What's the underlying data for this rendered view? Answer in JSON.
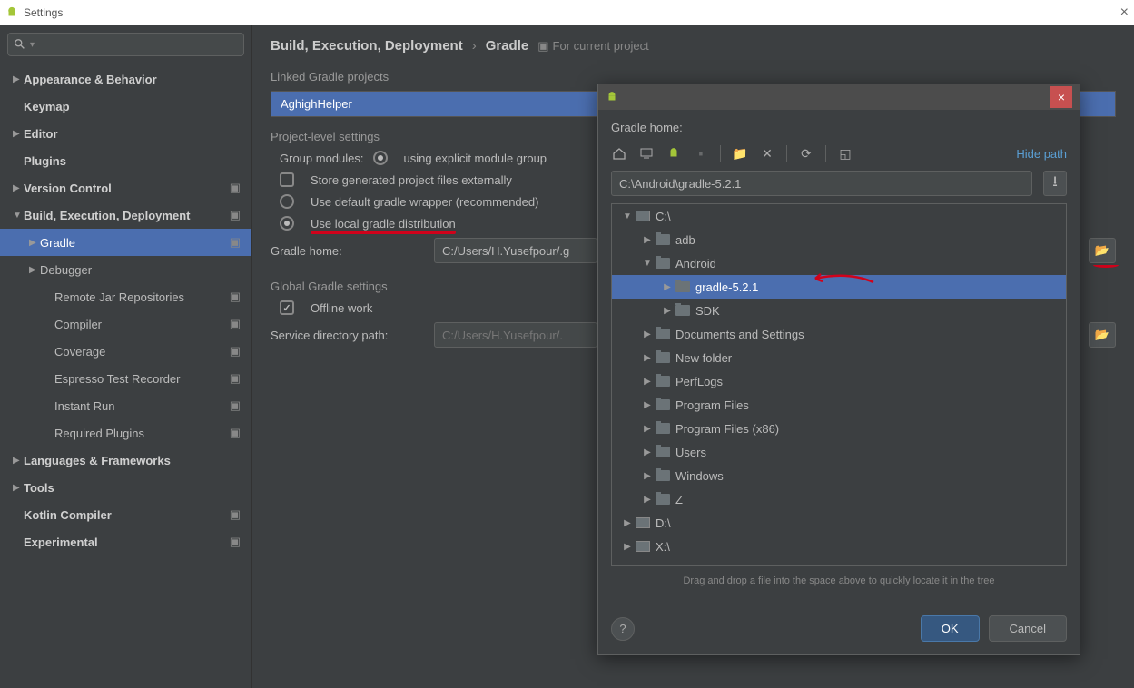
{
  "window": {
    "title": "Settings"
  },
  "sidebar": {
    "items": [
      {
        "label": "Appearance & Behavior",
        "bold": true,
        "expand": "▶"
      },
      {
        "label": "Keymap",
        "bold": true
      },
      {
        "label": "Editor",
        "bold": true,
        "expand": "▶"
      },
      {
        "label": "Plugins",
        "bold": true
      },
      {
        "label": "Version Control",
        "bold": true,
        "expand": "▶",
        "gear": true
      },
      {
        "label": "Build, Execution, Deployment",
        "bold": true,
        "expand": "▼",
        "gear": true
      },
      {
        "label": "Gradle",
        "lvl": 1,
        "expand": "▶",
        "selected": true,
        "gear": true
      },
      {
        "label": "Debugger",
        "lvl": 1,
        "expand": "▶"
      },
      {
        "label": "Remote Jar Repositories",
        "lvl": 2,
        "gear": true
      },
      {
        "label": "Compiler",
        "lvl": 2,
        "gear": true
      },
      {
        "label": "Coverage",
        "lvl": 2,
        "gear": true
      },
      {
        "label": "Espresso Test Recorder",
        "lvl": 2,
        "gear": true
      },
      {
        "label": "Instant Run",
        "lvl": 2,
        "gear": true
      },
      {
        "label": "Required Plugins",
        "lvl": 2,
        "gear": true
      },
      {
        "label": "Languages & Frameworks",
        "bold": true,
        "expand": "▶"
      },
      {
        "label": "Tools",
        "bold": true,
        "expand": "▶"
      },
      {
        "label": "Kotlin Compiler",
        "bold": true,
        "gear": true
      },
      {
        "label": "Experimental",
        "bold": true,
        "gear": true
      }
    ]
  },
  "breadcrumb": {
    "a": "Build, Execution, Deployment",
    "b": "Gradle",
    "forCurrent": "For current project"
  },
  "content": {
    "linked": "Linked Gradle projects",
    "project": "AghighHelper",
    "projectLevel": "Project-level settings",
    "groupModules": "Group modules:",
    "groupOption": "using explicit module group",
    "storeExt": "Store generated project files externally",
    "useDefault": "Use default gradle wrapper (recommended)",
    "useLocal": "Use local gradle distribution",
    "gradleHome": "Gradle home:",
    "gradleHomeValue": "C:/Users/H.Yusefpour/.g",
    "global": "Global Gradle settings",
    "offline": "Offline work",
    "serviceDir": "Service directory path:",
    "serviceDirValue": "C:/Users/H.Yusefpour/."
  },
  "dialog": {
    "label": "Gradle home:",
    "hidePath": "Hide path",
    "path": "C:\\Android\\gradle-5.2.1",
    "tree": [
      {
        "label": "C:\\",
        "lvl": 0,
        "exp": "▼",
        "type": "drive"
      },
      {
        "label": "adb",
        "lvl": 1,
        "exp": "▶",
        "type": "folder"
      },
      {
        "label": "Android",
        "lvl": 1,
        "exp": "▼",
        "type": "folder"
      },
      {
        "label": "gradle-5.2.1",
        "lvl": 2,
        "exp": "▶",
        "type": "folder",
        "sel": true
      },
      {
        "label": "SDK",
        "lvl": 2,
        "exp": "▶",
        "type": "folder"
      },
      {
        "label": "Documents and Settings",
        "lvl": 1,
        "exp": "▶",
        "type": "folder"
      },
      {
        "label": "New folder",
        "lvl": 1,
        "exp": "▶",
        "type": "folder"
      },
      {
        "label": "PerfLogs",
        "lvl": 1,
        "exp": "▶",
        "type": "folder"
      },
      {
        "label": "Program Files",
        "lvl": 1,
        "exp": "▶",
        "type": "folder"
      },
      {
        "label": "Program Files (x86)",
        "lvl": 1,
        "exp": "▶",
        "type": "folder"
      },
      {
        "label": "Users",
        "lvl": 1,
        "exp": "▶",
        "type": "folder"
      },
      {
        "label": "Windows",
        "lvl": 1,
        "exp": "▶",
        "type": "folder"
      },
      {
        "label": "Z",
        "lvl": 1,
        "exp": "▶",
        "type": "folder"
      },
      {
        "label": "D:\\",
        "lvl": 0,
        "exp": "▶",
        "type": "drive"
      },
      {
        "label": "X:\\",
        "lvl": 0,
        "exp": "▶",
        "type": "drive"
      }
    ],
    "hint": "Drag and drop a file into the space above to quickly locate it in the tree",
    "ok": "OK",
    "cancel": "Cancel"
  }
}
